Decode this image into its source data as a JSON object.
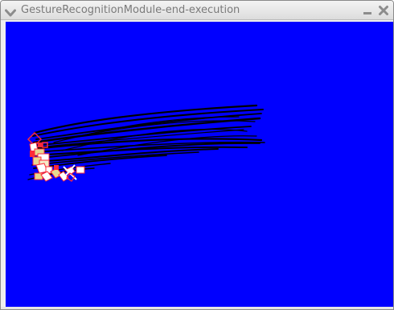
{
  "window": {
    "title": "GestureRecognitionModule-end-execution",
    "menu_icon": "chevron-down-icon",
    "minimize_icon": "minimize-icon",
    "close_icon": "close-icon"
  },
  "canvas": {
    "background_color": "#0000ff",
    "trajectory_color": "#000000",
    "hand_point_colors": [
      "#ff2a3a",
      "#ffffff",
      "#e8d890"
    ]
  }
}
